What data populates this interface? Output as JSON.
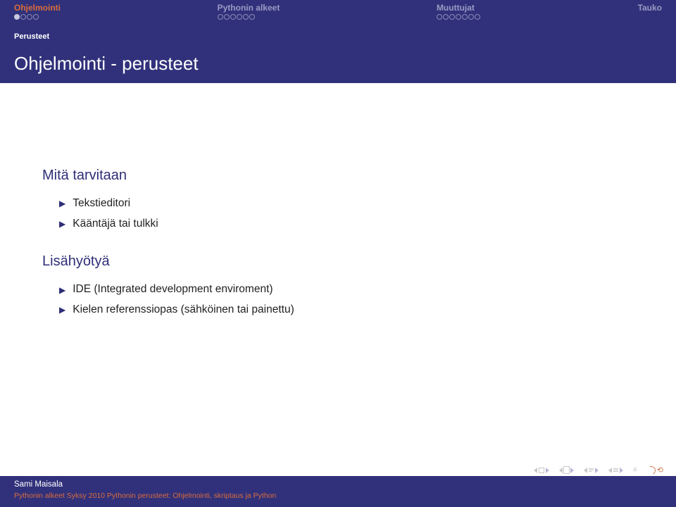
{
  "nav": {
    "sec1": "Ohjelmointi",
    "sec2": "Pythonin alkeet",
    "sec3": "Muuttujat",
    "sec4": "Tauko"
  },
  "subsection": "Perusteet",
  "title": "Ohjelmointi - perusteet",
  "block1": {
    "heading": "Mitä tarvitaan",
    "items": [
      "Tekstieditori",
      "Kääntäjä tai tulkki"
    ]
  },
  "block2": {
    "heading": "Lisähyötyä",
    "items": [
      "IDE (Integrated development enviroment)",
      "Kielen referenssiopas (sähköinen tai painettu)"
    ]
  },
  "footer": {
    "author": "Sami Maisala",
    "subtitle": "Pythonin alkeet Syksy 2010 Pythonin perusteet: Ohjelmointi, skriptaus ja Python"
  }
}
